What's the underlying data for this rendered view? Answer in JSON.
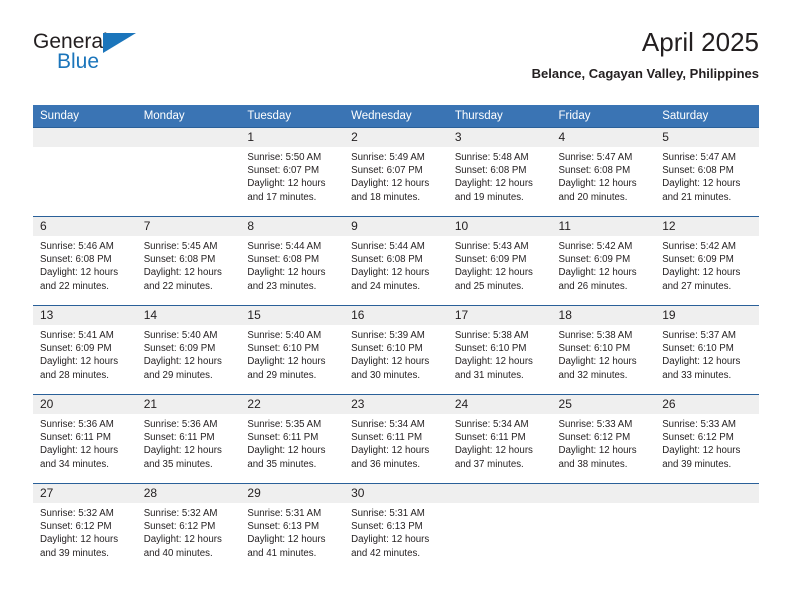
{
  "branding": {
    "logo_primary": "General",
    "logo_secondary": "Blue",
    "logo_color": "#1b75bb"
  },
  "header": {
    "title": "April 2025",
    "subtitle": "Belance, Cagayan Valley, Philippines"
  },
  "theme": {
    "header_row_bg": "#3a74b4",
    "daynum_bg": "#efefef",
    "row_border": "#2a6099"
  },
  "calendar": {
    "weekday_headers": [
      "Sunday",
      "Monday",
      "Tuesday",
      "Wednesday",
      "Thursday",
      "Friday",
      "Saturday"
    ],
    "weeks": [
      [
        {
          "day": "",
          "sunrise": "",
          "sunset": "",
          "daylight_line1": "",
          "daylight_line2": ""
        },
        {
          "day": "",
          "sunrise": "",
          "sunset": "",
          "daylight_line1": "",
          "daylight_line2": ""
        },
        {
          "day": "1",
          "sunrise": "Sunrise: 5:50 AM",
          "sunset": "Sunset: 6:07 PM",
          "daylight_line1": "Daylight: 12 hours",
          "daylight_line2": "and 17 minutes."
        },
        {
          "day": "2",
          "sunrise": "Sunrise: 5:49 AM",
          "sunset": "Sunset: 6:07 PM",
          "daylight_line1": "Daylight: 12 hours",
          "daylight_line2": "and 18 minutes."
        },
        {
          "day": "3",
          "sunrise": "Sunrise: 5:48 AM",
          "sunset": "Sunset: 6:08 PM",
          "daylight_line1": "Daylight: 12 hours",
          "daylight_line2": "and 19 minutes."
        },
        {
          "day": "4",
          "sunrise": "Sunrise: 5:47 AM",
          "sunset": "Sunset: 6:08 PM",
          "daylight_line1": "Daylight: 12 hours",
          "daylight_line2": "and 20 minutes."
        },
        {
          "day": "5",
          "sunrise": "Sunrise: 5:47 AM",
          "sunset": "Sunset: 6:08 PM",
          "daylight_line1": "Daylight: 12 hours",
          "daylight_line2": "and 21 minutes."
        }
      ],
      [
        {
          "day": "6",
          "sunrise": "Sunrise: 5:46 AM",
          "sunset": "Sunset: 6:08 PM",
          "daylight_line1": "Daylight: 12 hours",
          "daylight_line2": "and 22 minutes."
        },
        {
          "day": "7",
          "sunrise": "Sunrise: 5:45 AM",
          "sunset": "Sunset: 6:08 PM",
          "daylight_line1": "Daylight: 12 hours",
          "daylight_line2": "and 22 minutes."
        },
        {
          "day": "8",
          "sunrise": "Sunrise: 5:44 AM",
          "sunset": "Sunset: 6:08 PM",
          "daylight_line1": "Daylight: 12 hours",
          "daylight_line2": "and 23 minutes."
        },
        {
          "day": "9",
          "sunrise": "Sunrise: 5:44 AM",
          "sunset": "Sunset: 6:08 PM",
          "daylight_line1": "Daylight: 12 hours",
          "daylight_line2": "and 24 minutes."
        },
        {
          "day": "10",
          "sunrise": "Sunrise: 5:43 AM",
          "sunset": "Sunset: 6:09 PM",
          "daylight_line1": "Daylight: 12 hours",
          "daylight_line2": "and 25 minutes."
        },
        {
          "day": "11",
          "sunrise": "Sunrise: 5:42 AM",
          "sunset": "Sunset: 6:09 PM",
          "daylight_line1": "Daylight: 12 hours",
          "daylight_line2": "and 26 minutes."
        },
        {
          "day": "12",
          "sunrise": "Sunrise: 5:42 AM",
          "sunset": "Sunset: 6:09 PM",
          "daylight_line1": "Daylight: 12 hours",
          "daylight_line2": "and 27 minutes."
        }
      ],
      [
        {
          "day": "13",
          "sunrise": "Sunrise: 5:41 AM",
          "sunset": "Sunset: 6:09 PM",
          "daylight_line1": "Daylight: 12 hours",
          "daylight_line2": "and 28 minutes."
        },
        {
          "day": "14",
          "sunrise": "Sunrise: 5:40 AM",
          "sunset": "Sunset: 6:09 PM",
          "daylight_line1": "Daylight: 12 hours",
          "daylight_line2": "and 29 minutes."
        },
        {
          "day": "15",
          "sunrise": "Sunrise: 5:40 AM",
          "sunset": "Sunset: 6:10 PM",
          "daylight_line1": "Daylight: 12 hours",
          "daylight_line2": "and 29 minutes."
        },
        {
          "day": "16",
          "sunrise": "Sunrise: 5:39 AM",
          "sunset": "Sunset: 6:10 PM",
          "daylight_line1": "Daylight: 12 hours",
          "daylight_line2": "and 30 minutes."
        },
        {
          "day": "17",
          "sunrise": "Sunrise: 5:38 AM",
          "sunset": "Sunset: 6:10 PM",
          "daylight_line1": "Daylight: 12 hours",
          "daylight_line2": "and 31 minutes."
        },
        {
          "day": "18",
          "sunrise": "Sunrise: 5:38 AM",
          "sunset": "Sunset: 6:10 PM",
          "daylight_line1": "Daylight: 12 hours",
          "daylight_line2": "and 32 minutes."
        },
        {
          "day": "19",
          "sunrise": "Sunrise: 5:37 AM",
          "sunset": "Sunset: 6:10 PM",
          "daylight_line1": "Daylight: 12 hours",
          "daylight_line2": "and 33 minutes."
        }
      ],
      [
        {
          "day": "20",
          "sunrise": "Sunrise: 5:36 AM",
          "sunset": "Sunset: 6:11 PM",
          "daylight_line1": "Daylight: 12 hours",
          "daylight_line2": "and 34 minutes."
        },
        {
          "day": "21",
          "sunrise": "Sunrise: 5:36 AM",
          "sunset": "Sunset: 6:11 PM",
          "daylight_line1": "Daylight: 12 hours",
          "daylight_line2": "and 35 minutes."
        },
        {
          "day": "22",
          "sunrise": "Sunrise: 5:35 AM",
          "sunset": "Sunset: 6:11 PM",
          "daylight_line1": "Daylight: 12 hours",
          "daylight_line2": "and 35 minutes."
        },
        {
          "day": "23",
          "sunrise": "Sunrise: 5:34 AM",
          "sunset": "Sunset: 6:11 PM",
          "daylight_line1": "Daylight: 12 hours",
          "daylight_line2": "and 36 minutes."
        },
        {
          "day": "24",
          "sunrise": "Sunrise: 5:34 AM",
          "sunset": "Sunset: 6:11 PM",
          "daylight_line1": "Daylight: 12 hours",
          "daylight_line2": "and 37 minutes."
        },
        {
          "day": "25",
          "sunrise": "Sunrise: 5:33 AM",
          "sunset": "Sunset: 6:12 PM",
          "daylight_line1": "Daylight: 12 hours",
          "daylight_line2": "and 38 minutes."
        },
        {
          "day": "26",
          "sunrise": "Sunrise: 5:33 AM",
          "sunset": "Sunset: 6:12 PM",
          "daylight_line1": "Daylight: 12 hours",
          "daylight_line2": "and 39 minutes."
        }
      ],
      [
        {
          "day": "27",
          "sunrise": "Sunrise: 5:32 AM",
          "sunset": "Sunset: 6:12 PM",
          "daylight_line1": "Daylight: 12 hours",
          "daylight_line2": "and 39 minutes."
        },
        {
          "day": "28",
          "sunrise": "Sunrise: 5:32 AM",
          "sunset": "Sunset: 6:12 PM",
          "daylight_line1": "Daylight: 12 hours",
          "daylight_line2": "and 40 minutes."
        },
        {
          "day": "29",
          "sunrise": "Sunrise: 5:31 AM",
          "sunset": "Sunset: 6:13 PM",
          "daylight_line1": "Daylight: 12 hours",
          "daylight_line2": "and 41 minutes."
        },
        {
          "day": "30",
          "sunrise": "Sunrise: 5:31 AM",
          "sunset": "Sunset: 6:13 PM",
          "daylight_line1": "Daylight: 12 hours",
          "daylight_line2": "and 42 minutes."
        },
        {
          "day": "",
          "sunrise": "",
          "sunset": "",
          "daylight_line1": "",
          "daylight_line2": ""
        },
        {
          "day": "",
          "sunrise": "",
          "sunset": "",
          "daylight_line1": "",
          "daylight_line2": ""
        },
        {
          "day": "",
          "sunrise": "",
          "sunset": "",
          "daylight_line1": "",
          "daylight_line2": ""
        }
      ]
    ]
  }
}
